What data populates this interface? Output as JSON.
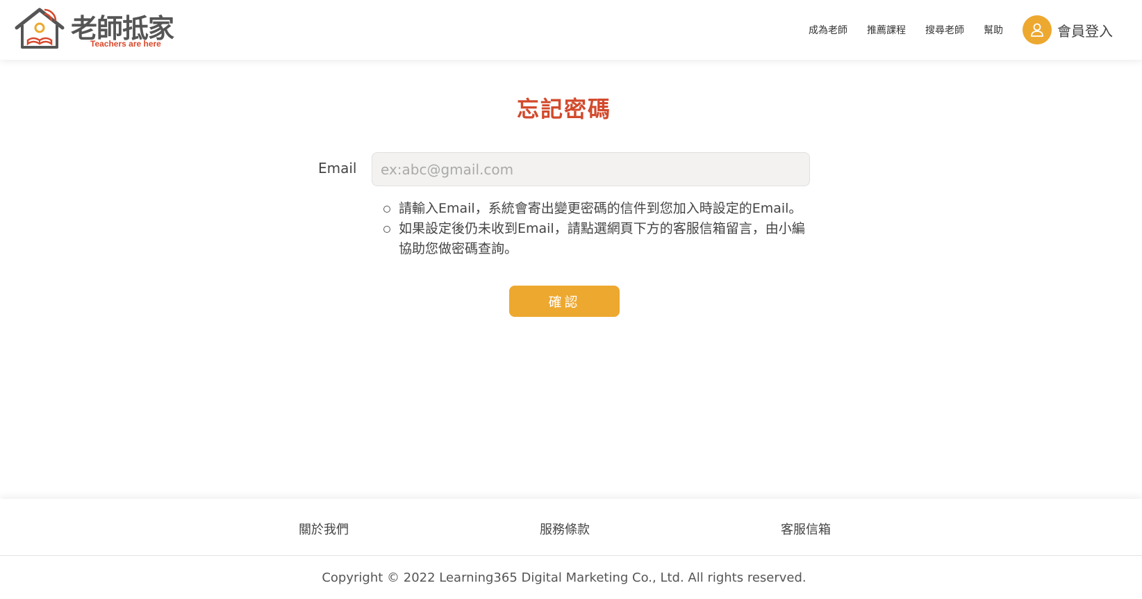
{
  "brand": {
    "title": "老師抵家",
    "subtitle": "Teachers are here",
    "accent": "#eda82f",
    "title_color": "#d24a2c"
  },
  "nav": {
    "items": [
      {
        "label": "成為老師"
      },
      {
        "label": "推薦課程"
      },
      {
        "label": "搜尋老師"
      },
      {
        "label": "幫助"
      }
    ],
    "login_label": "會員登入"
  },
  "form": {
    "title": "忘記密碼",
    "email_label": "Email",
    "email_placeholder": "ex:abc@gmail.com",
    "email_value": "",
    "notes": [
      "請輸入Email，系統會寄出變更密碼的信件到您加入時設定的Email。",
      "如果設定後仍未收到Email，請點選網頁下方的客服信箱留言，由小編協助您做密碼查詢。"
    ],
    "confirm_label": "確認"
  },
  "footer": {
    "links": [
      {
        "label": "關於我們"
      },
      {
        "label": "服務條款"
      },
      {
        "label": "客服信箱"
      }
    ],
    "copyright": "Copyright © 2022 Learning365 Digital Marketing Co., Ltd. All rights reserved."
  }
}
